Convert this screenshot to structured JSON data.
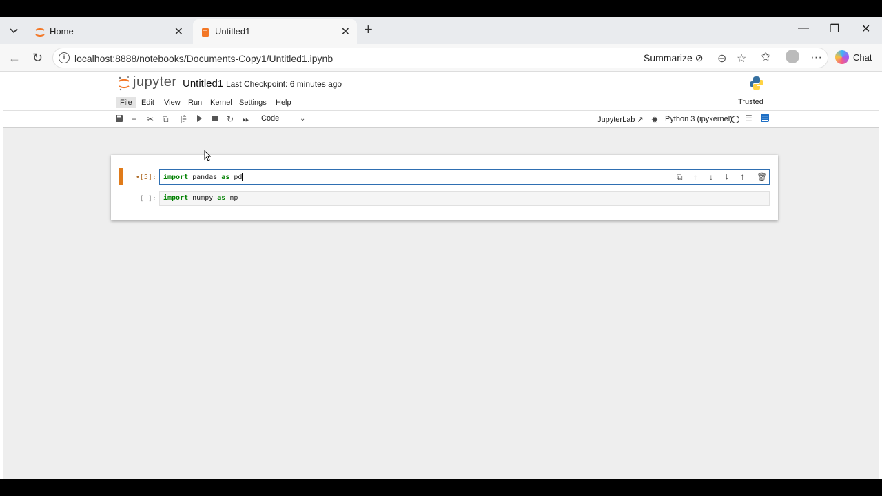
{
  "browser": {
    "tabs": [
      {
        "label": "Home"
      },
      {
        "label": "Untitled1"
      }
    ],
    "url": "localhost:8888/notebooks/Documents-Copy1/Untitled1.ipynb",
    "summarize_label": "Summarize",
    "chat_label": "Chat"
  },
  "jupyter": {
    "logo_text": "jupyter",
    "notebook_title": "Untitled1",
    "checkpoint": "Last Checkpoint: 6 minutes ago",
    "menus": [
      "File",
      "Edit",
      "View",
      "Run",
      "Kernel",
      "Settings",
      "Help"
    ],
    "trusted": "Trusted",
    "cell_type": "Code",
    "jupyterlab_link": "JupyterLab",
    "kernel": "Python 3 (ipykernel)"
  },
  "cells": [
    {
      "prompt": "•[5]:",
      "kw1": "import",
      "mod": " pandas ",
      "kw2": "as",
      "alias": " pd"
    },
    {
      "prompt": "[ ]:",
      "kw1": "import",
      "mod": " numpy ",
      "kw2": "as",
      "alias": " np"
    }
  ],
  "colors": {
    "accent_orange": "#e07b1a",
    "active_border": "#2f6fb2",
    "keyword": "#008000"
  }
}
